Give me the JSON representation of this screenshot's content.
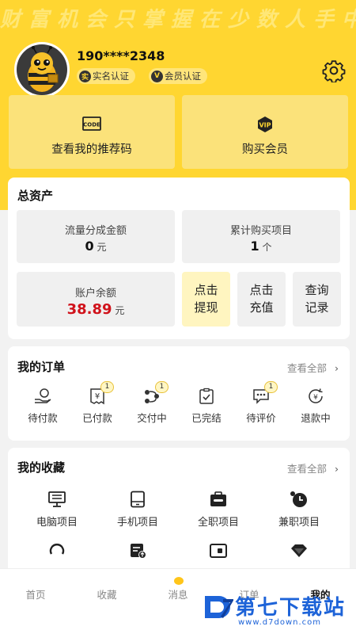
{
  "banner": "财富机会只掌握在少数人手中",
  "user": {
    "phone": "190****2348",
    "badge_realname": "实名认证",
    "badge_member": "会员认证"
  },
  "top_actions": [
    {
      "label": "查看我的推荐码",
      "icon": "code-icon"
    },
    {
      "label": "购买会员",
      "icon": "vip-icon"
    }
  ],
  "assets": {
    "title": "总资产",
    "flow_label": "流量分成金额",
    "flow_value": "0",
    "flow_unit": "元",
    "projects_label": "累计购买项目",
    "projects_value": "1",
    "projects_unit": "个",
    "balance_label": "账户余额",
    "balance_value": "38.89",
    "balance_unit": "元",
    "withdraw": [
      "点击",
      "提现"
    ],
    "recharge": [
      "点击",
      "充值"
    ],
    "records": [
      "查询",
      "记录"
    ]
  },
  "orders": {
    "title": "我的订单",
    "view_all": "查看全部",
    "items": [
      {
        "label": "待付款",
        "count": ""
      },
      {
        "label": "已付款",
        "count": "1"
      },
      {
        "label": "交付中",
        "count": "1"
      },
      {
        "label": "已完结",
        "count": ""
      },
      {
        "label": "待评价",
        "count": "1"
      },
      {
        "label": "退款中",
        "count": ""
      }
    ]
  },
  "favorites": {
    "title": "我的收藏",
    "view_all": "查看全部",
    "items": [
      {
        "label": "电脑项目",
        "icon": "computer-icon"
      },
      {
        "label": "手机项目",
        "icon": "phone-icon"
      },
      {
        "label": "全职项目",
        "icon": "fulltime-icon"
      },
      {
        "label": "兼职项目",
        "icon": "parttime-icon"
      }
    ]
  },
  "tabs": [
    "首页",
    "收藏",
    "消息",
    "订单",
    "我的"
  ],
  "watermark": {
    "title": "第七下载站",
    "url": "www.d7down.com"
  },
  "colors": {
    "brand_yellow": "#ffd631",
    "balance_red": "#d0121b",
    "watermark_blue": "#1d63d8"
  }
}
